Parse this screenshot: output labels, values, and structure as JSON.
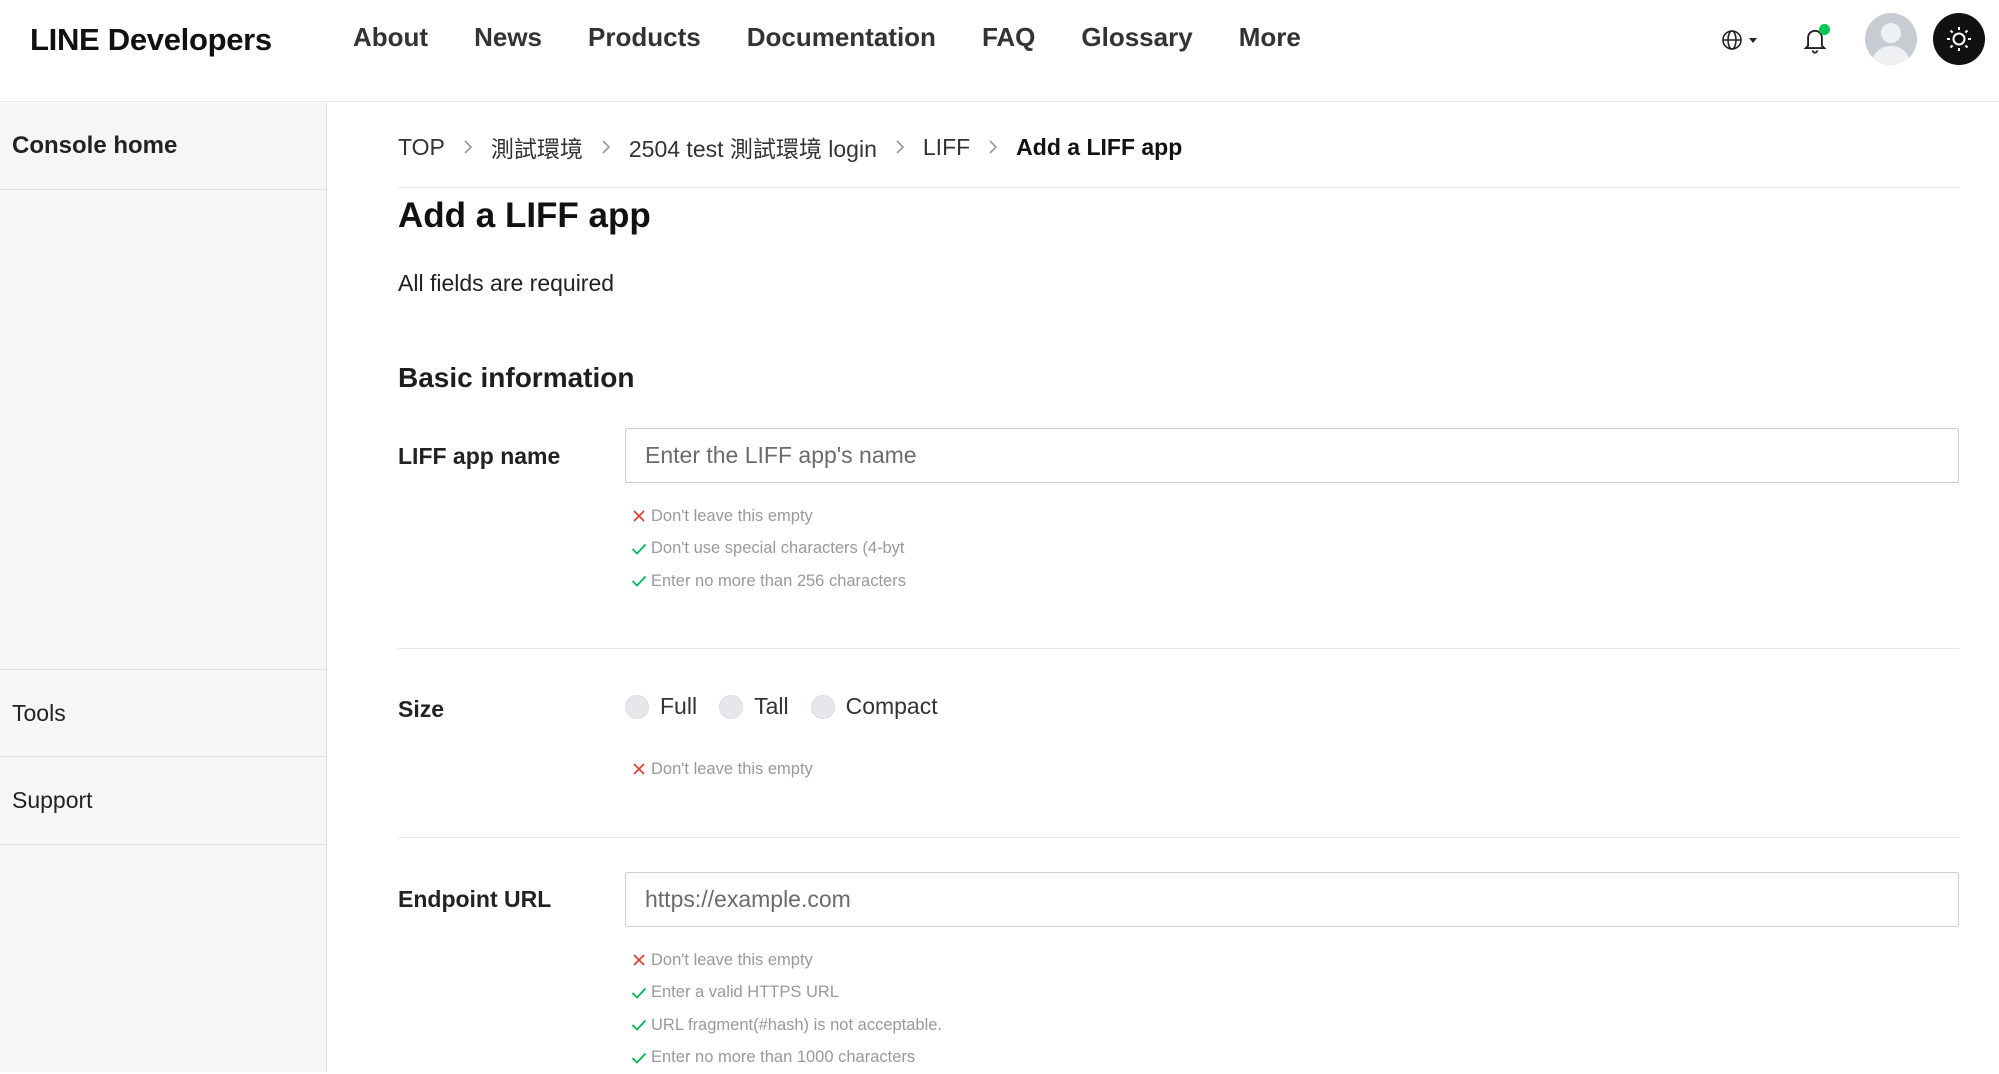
{
  "header": {
    "brand": "LINE Developers",
    "nav": [
      "About",
      "News",
      "Products",
      "Documentation",
      "FAQ",
      "Glossary",
      "More"
    ],
    "icons": {
      "language": "globe-icon",
      "notifications": "bell-icon",
      "avatar": "user-avatar",
      "theme": "sun-icon"
    },
    "colors": {
      "notification_dot": "#06c755",
      "theme_button": "#111111"
    }
  },
  "sidebar": {
    "home": "Console home",
    "tools": "Tools",
    "support": "Support"
  },
  "breadcrumb": [
    "TOP",
    "測試環境",
    "2504 test 測試環境 login",
    "LIFF",
    "Add a LIFF app"
  ],
  "page": {
    "title": "Add a LIFF app",
    "required_note": "All fields are required",
    "section_title": "Basic information"
  },
  "form": {
    "liff_name": {
      "label": "LIFF app name",
      "placeholder": "Enter the LIFF app's name",
      "value": "",
      "rules": [
        {
          "text": "Don't leave this empty",
          "status": "fail"
        },
        {
          "text": "Don't use special characters (4-byt",
          "status": "pass"
        },
        {
          "text": "Enter no more than 256 characters",
          "status": "pass"
        }
      ]
    },
    "size": {
      "label": "Size",
      "options": [
        "Full",
        "Tall",
        "Compact"
      ],
      "selected": "",
      "rules": [
        {
          "text": "Don't leave this empty",
          "status": "fail"
        }
      ]
    },
    "endpoint": {
      "label": "Endpoint URL",
      "placeholder": "https://example.com",
      "value": "",
      "rules": [
        {
          "text": "Don't leave this empty",
          "status": "fail"
        },
        {
          "text": "Enter a valid HTTPS URL",
          "status": "pass"
        },
        {
          "text": "URL fragment(#hash) is not acceptable.",
          "status": "pass"
        },
        {
          "text": "Enter no more than 1000 characters",
          "status": "pass"
        }
      ]
    }
  },
  "status_colors": {
    "fail": "#e0413a",
    "pass": "#06b355"
  }
}
